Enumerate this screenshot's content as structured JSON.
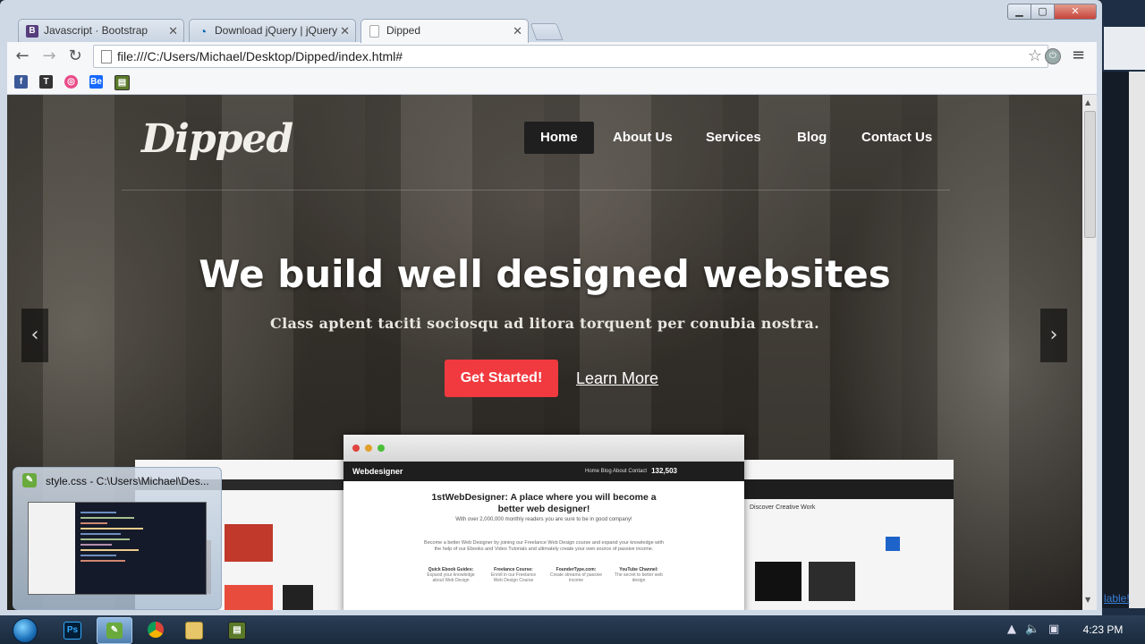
{
  "browser": {
    "tabs": [
      {
        "label": "Javascript · Bootstrap",
        "icon": "bootstrap-icon"
      },
      {
        "label": "Download jQuery | jQuery",
        "icon": "jquery-icon"
      },
      {
        "label": "Dipped",
        "icon": "page-icon"
      }
    ],
    "url": "file:///C:/Users/Michael/Desktop/Dipped/index.html#",
    "bookmarks": [
      "facebook-icon",
      "tumblr-icon",
      "dribbble-icon",
      "behance-icon",
      "bookmark-app-icon"
    ]
  },
  "site": {
    "logo": "Dipped",
    "nav": [
      "Home",
      "About Us",
      "Services",
      "Blog",
      "Contact Us"
    ],
    "headline": "We build well designed websites",
    "subheadline": "Class aptent taciti sociosqu ad litora torquent per conubia nostra.",
    "cta": "Get Started!",
    "learn_more": "Learn More",
    "prev": "‹",
    "next": "›"
  },
  "mockup": {
    "logo": "Webdesigner",
    "nav_items": "Home   Blog   About   Contact",
    "count": "132,503",
    "title": "1stWebDesigner: A place where you will become a better web designer!",
    "subtitle": "With over 2,000,000 monthly readers you are sure to be in good company!",
    "paragraph": "Become a better Web Designer by joining our Freelance Web Design course and expand your knowledge with the help of our Ebooks and Video Tutorials and ultimately create your own source of passive income.",
    "columns": [
      {
        "title": "Quick Ebook Guides:",
        "text": "Expand your knowledge about Web Design"
      },
      {
        "title": "Freelance Course:",
        "text": "Enroll in our Freelance Web Design Course"
      },
      {
        "title": "FounderType.com:",
        "text": "Create streams of passive income"
      },
      {
        "title": "YouTube Channel:",
        "text": "The secret to better web design"
      }
    ],
    "right_title": "Discover Creative Work"
  },
  "partial_link": "lable!",
  "preview": {
    "title": "style.css - C:\\Users\\Michael\\Des..."
  },
  "taskbar": {
    "time": "4:23 PM"
  }
}
